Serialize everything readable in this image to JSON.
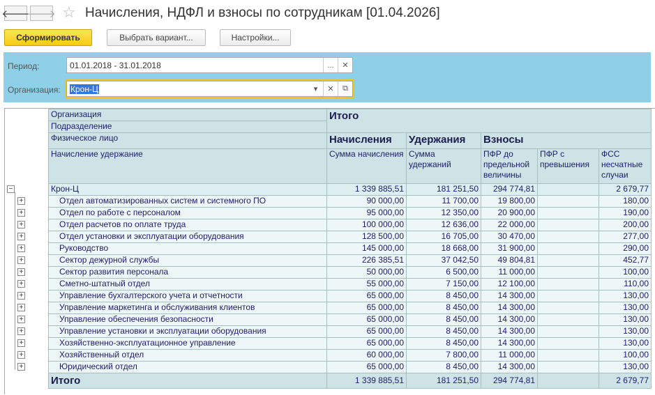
{
  "window": {
    "title": "Начисления, НДФЛ и взносы по сотрудникам [01.04.2026]"
  },
  "toolbar": {
    "generate": "Сформировать",
    "choose_variant": "Выбрать вариант...",
    "settings": "Настройки..."
  },
  "filters": {
    "period_label": "Период:",
    "period_value": "01.01.2018 - 31.01.2018",
    "org_label": "Организация:",
    "org_value": "Крон-Ц"
  },
  "report": {
    "header": {
      "org": "Организация",
      "dept": "Подразделение",
      "person": "Физическое лицо",
      "accrual": "Начисление удержание",
      "total": "Итого",
      "accruals": "Начисления",
      "deductions": "Удержания",
      "contributions": "Взносы",
      "c1": "Сумма начисления",
      "c2": "Сумма удержаний",
      "c3": "ПФР до предельной величины",
      "c4": "ПФР с превышения",
      "c5": "ФСС несчатные случаи"
    },
    "org_row": {
      "name": "Крон-Ц",
      "v": [
        "1 339 885,51",
        "181 251,50",
        "294 774,81",
        "",
        "2 679,77"
      ]
    },
    "rows": [
      {
        "name": "Отдел автоматизированных систем и системного ПО",
        "v": [
          "90 000,00",
          "11 700,00",
          "19 800,00",
          "",
          "180,00"
        ]
      },
      {
        "name": "Отдел по работе с персоналом",
        "v": [
          "95 000,00",
          "12 350,00",
          "20 900,00",
          "",
          "190,00"
        ]
      },
      {
        "name": "Отдел расчетов по оплате труда",
        "v": [
          "100 000,00",
          "12 636,00",
          "22 000,00",
          "",
          "200,00"
        ]
      },
      {
        "name": "Отдел установки и эксплуатации оборудования",
        "v": [
          "128 500,00",
          "16 705,00",
          "30 470,00",
          "",
          "277,00"
        ]
      },
      {
        "name": "Руководство",
        "v": [
          "145 000,00",
          "18 668,00",
          "31 900,00",
          "",
          "290,00"
        ]
      },
      {
        "name": "Сектор дежурной службы",
        "v": [
          "226 385,51",
          "37 042,50",
          "49 804,81",
          "",
          "452,77"
        ]
      },
      {
        "name": "Сектор развития персонала",
        "v": [
          "50 000,00",
          "6 500,00",
          "11 000,00",
          "",
          "100,00"
        ]
      },
      {
        "name": "Сметно-штатный отдел",
        "v": [
          "55 000,00",
          "7 150,00",
          "12 100,00",
          "",
          "110,00"
        ]
      },
      {
        "name": "Управление бухгалтерского учета и отчетности",
        "v": [
          "65 000,00",
          "8 450,00",
          "14 300,00",
          "",
          "130,00"
        ]
      },
      {
        "name": "Управление маркетинга и обслуживания клиентов",
        "v": [
          "65 000,00",
          "8 450,00",
          "14 300,00",
          "",
          "130,00"
        ]
      },
      {
        "name": "Управление обеспечения безопасности",
        "v": [
          "65 000,00",
          "8 450,00",
          "14 300,00",
          "",
          "130,00"
        ]
      },
      {
        "name": "Управление установки и эксплуатации оборудования",
        "v": [
          "65 000,00",
          "8 450,00",
          "14 300,00",
          "",
          "130,00"
        ]
      },
      {
        "name": "Хозяйственно-эксплуатационное управление",
        "v": [
          "65 000,00",
          "8 450,00",
          "14 300,00",
          "",
          "130,00"
        ]
      },
      {
        "name": "Хозяйственный отдел",
        "v": [
          "60 000,00",
          "7 800,00",
          "11 000,00",
          "",
          "100,00"
        ]
      },
      {
        "name": "Юридический отдел",
        "v": [
          "65 000,00",
          "8 450,00",
          "14 300,00",
          "",
          "130,00"
        ]
      }
    ],
    "total_row": {
      "name": "Итого",
      "v": [
        "1 339 885,51",
        "181 251,50",
        "294 774,81",
        "",
        "2 679,77"
      ]
    }
  }
}
